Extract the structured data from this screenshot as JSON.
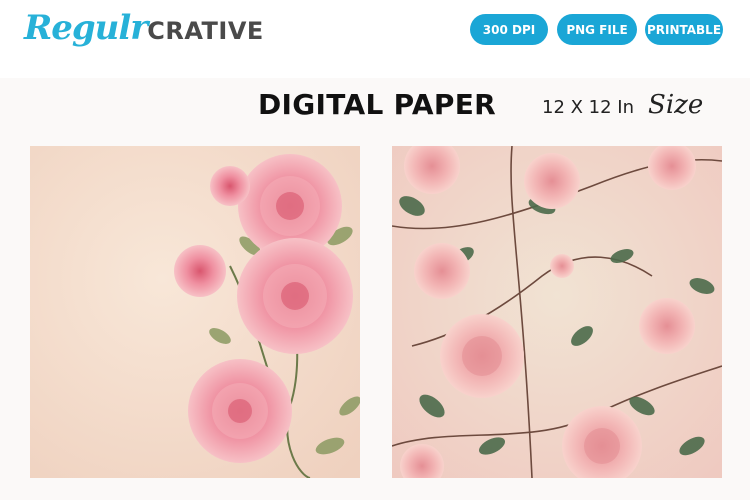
{
  "brand": {
    "script": "Regulr",
    "block": "CRATIVE"
  },
  "badges": [
    "300 DPI",
    "PNG FILE",
    "PRINTABLE"
  ],
  "title": "DIGITAL PAPER",
  "size": {
    "text": "12 X 12 In",
    "script": "Size"
  },
  "papers": [
    {
      "name": "paper-left",
      "description": "cream paper with pink roses"
    },
    {
      "name": "paper-right",
      "description": "pink paper with roses and leaves"
    }
  ]
}
